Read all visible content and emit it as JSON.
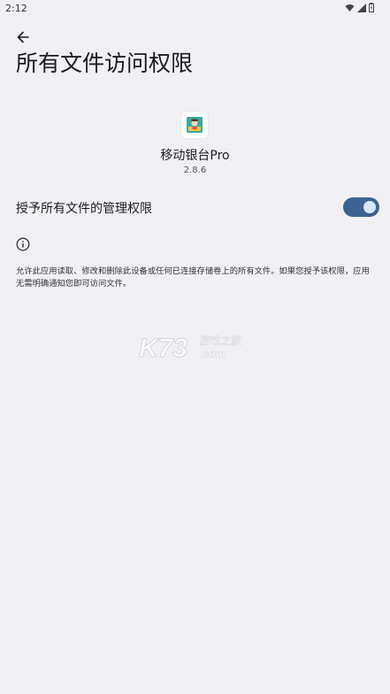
{
  "status_bar": {
    "time": "2:12",
    "icons": [
      "wifi-icon",
      "signal-icon",
      "battery-icon"
    ]
  },
  "header": {
    "back_icon": "arrow-left-icon",
    "title": "所有文件访问权限"
  },
  "app": {
    "name": "移动银台Pro",
    "version": "2.8.6"
  },
  "permission": {
    "label": "授予所有文件的管理权限",
    "enabled": true,
    "accent_color": "#3d6393"
  },
  "info": {
    "icon": "info-icon",
    "description": "允许此应用读取、修改和删除此设备或任何已连接存储卷上的所有文件。如果您授予该权限，应用无需明确通知您即可访问文件。"
  },
  "watermark": {
    "brand": "K73",
    "site_cn": "游戏之家",
    "domain": ".com"
  }
}
